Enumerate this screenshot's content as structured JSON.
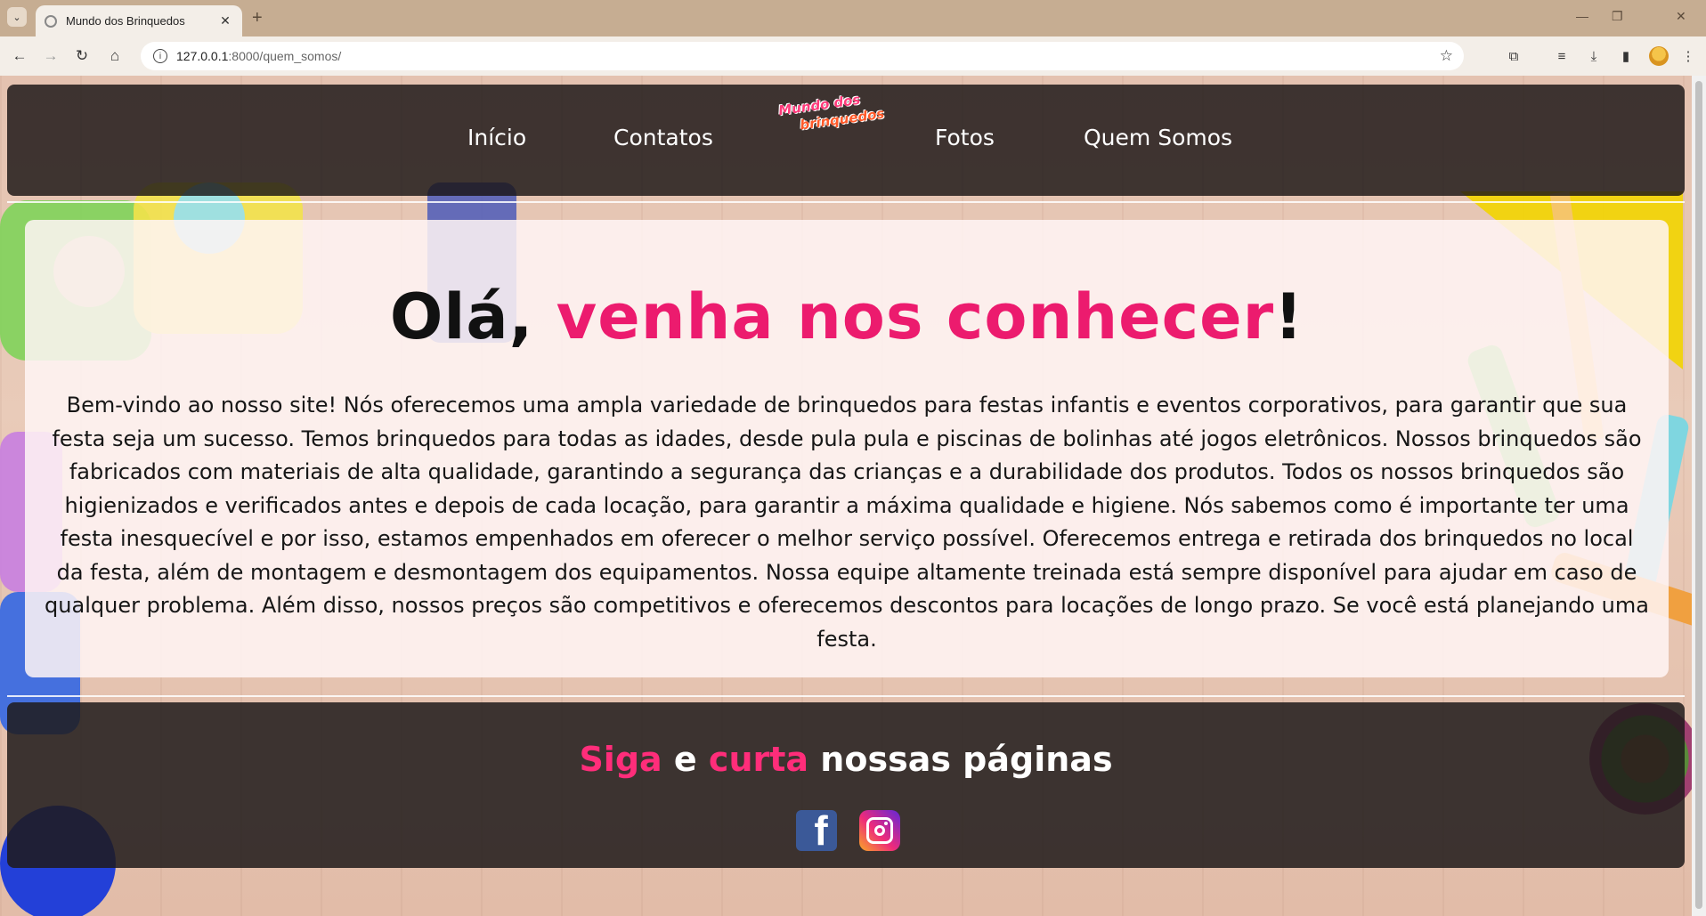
{
  "browser": {
    "tab_title": "Mundo dos Brinquedos",
    "url_host": "127.0.0.1",
    "url_path": ":8000/quem_somos/"
  },
  "nav": {
    "items": [
      {
        "label": "Início"
      },
      {
        "label": "Contatos"
      },
      {
        "label": "Fotos"
      },
      {
        "label": "Quem Somos"
      }
    ],
    "logo_line1": "Mundo dos",
    "logo_line2": "brinquedos"
  },
  "main": {
    "heading_plain": "Olá, ",
    "heading_pink": "venha nos conhecer",
    "heading_end": "!",
    "body": "Bem-vindo ao nosso site! Nós oferecemos uma ampla variedade de brinquedos para festas infantis e eventos corporativos, para garantir que sua festa seja um sucesso. Temos brinquedos para todas as idades, desde pula pula e piscinas de bolinhas até jogos eletrônicos. Nossos brinquedos são fabricados com materiais de alta qualidade, garantindo a segurança das crianças e a durabilidade dos produtos. Todos os nossos brinquedos são higienizados e verificados antes e depois de cada locação, para garantir a máxima qualidade e higiene. Nós sabemos como é importante ter uma festa inesquecível e por isso, estamos empenhados em oferecer o melhor serviço possível. Oferecemos entrega e retirada dos brinquedos no local da festa, além de montagem e desmontagem dos equipamentos. Nossa equipe altamente treinada está sempre disponível para ajudar em caso de qualquer problema. Além disso, nossos preços são competitivos e oferecemos descontos para locações de longo prazo. Se você está planejando uma festa."
  },
  "footer": {
    "word1": "Siga",
    "word2": " e ",
    "word3": "curta",
    "word4": " nossas páginas",
    "facebook_glyph": "f"
  },
  "colors": {
    "accent_pink": "#ec1b6e",
    "bar_dark": "#191414"
  },
  "icons": [
    "tab-list-icon",
    "favicon-icon",
    "close-icon",
    "new-tab-icon",
    "back-icon",
    "forward-icon",
    "reload-icon",
    "home-icon",
    "site-info-icon",
    "bookmark-star-icon",
    "extensions-icon",
    "media-icon",
    "download-icon",
    "sidebar-icon",
    "profile-icon",
    "menu-icon",
    "facebook-icon",
    "instagram-icon"
  ]
}
